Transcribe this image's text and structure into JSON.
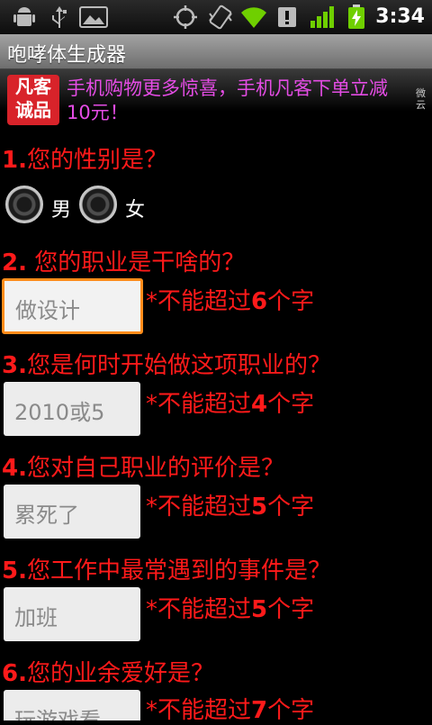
{
  "statusbar": {
    "time": "3:34",
    "icons": [
      "android-debug-icon",
      "usb-icon",
      "gallery-icon",
      "gps-icon",
      "vibrate-icon",
      "wifi-icon",
      "alert-icon",
      "signal-icon",
      "battery-charging-icon"
    ]
  },
  "app": {
    "title": "咆哮体生成器"
  },
  "ad": {
    "logo_line1": "凡客",
    "logo_line2": "诚品",
    "text": "手机购物更多惊喜，手机凡客下单立减10元！",
    "side_label": "微云"
  },
  "form": {
    "q1": {
      "num": "1.",
      "text": "您的性别是？"
    },
    "gender": {
      "male": "男",
      "female": "女"
    },
    "q2": {
      "num": "2.",
      "text": " 您的职业是干啥的？",
      "value": "做设计",
      "hint_pre": "*不能超过",
      "hint_num": "6",
      "hint_post": "个字"
    },
    "q3": {
      "num": "3.",
      "text": "您是何时开始做这项职业的？",
      "value": "2010或5",
      "hint_pre": "*不能超过",
      "hint_num": "4",
      "hint_post": "个字"
    },
    "q4": {
      "num": "4.",
      "text": "您对自己职业的评价是？",
      "value": "累死了",
      "hint_pre": "*不能超过",
      "hint_num": "5",
      "hint_post": "个字"
    },
    "q5": {
      "num": "5.",
      "text": "您工作中最常遇到的事件是？",
      "value": "加班",
      "hint_pre": "*不能超过",
      "hint_num": "5",
      "hint_post": "个字"
    },
    "q6": {
      "num": "6.",
      "text": "您的业余爱好是？",
      "value": "玩游戏看",
      "hint_pre": "*不能超过",
      "hint_num": "7",
      "hint_post": "个字"
    }
  },
  "colors": {
    "question": "#ff1a1a",
    "ad_text": "#e44ce4",
    "focus": "#ff8c1a"
  }
}
